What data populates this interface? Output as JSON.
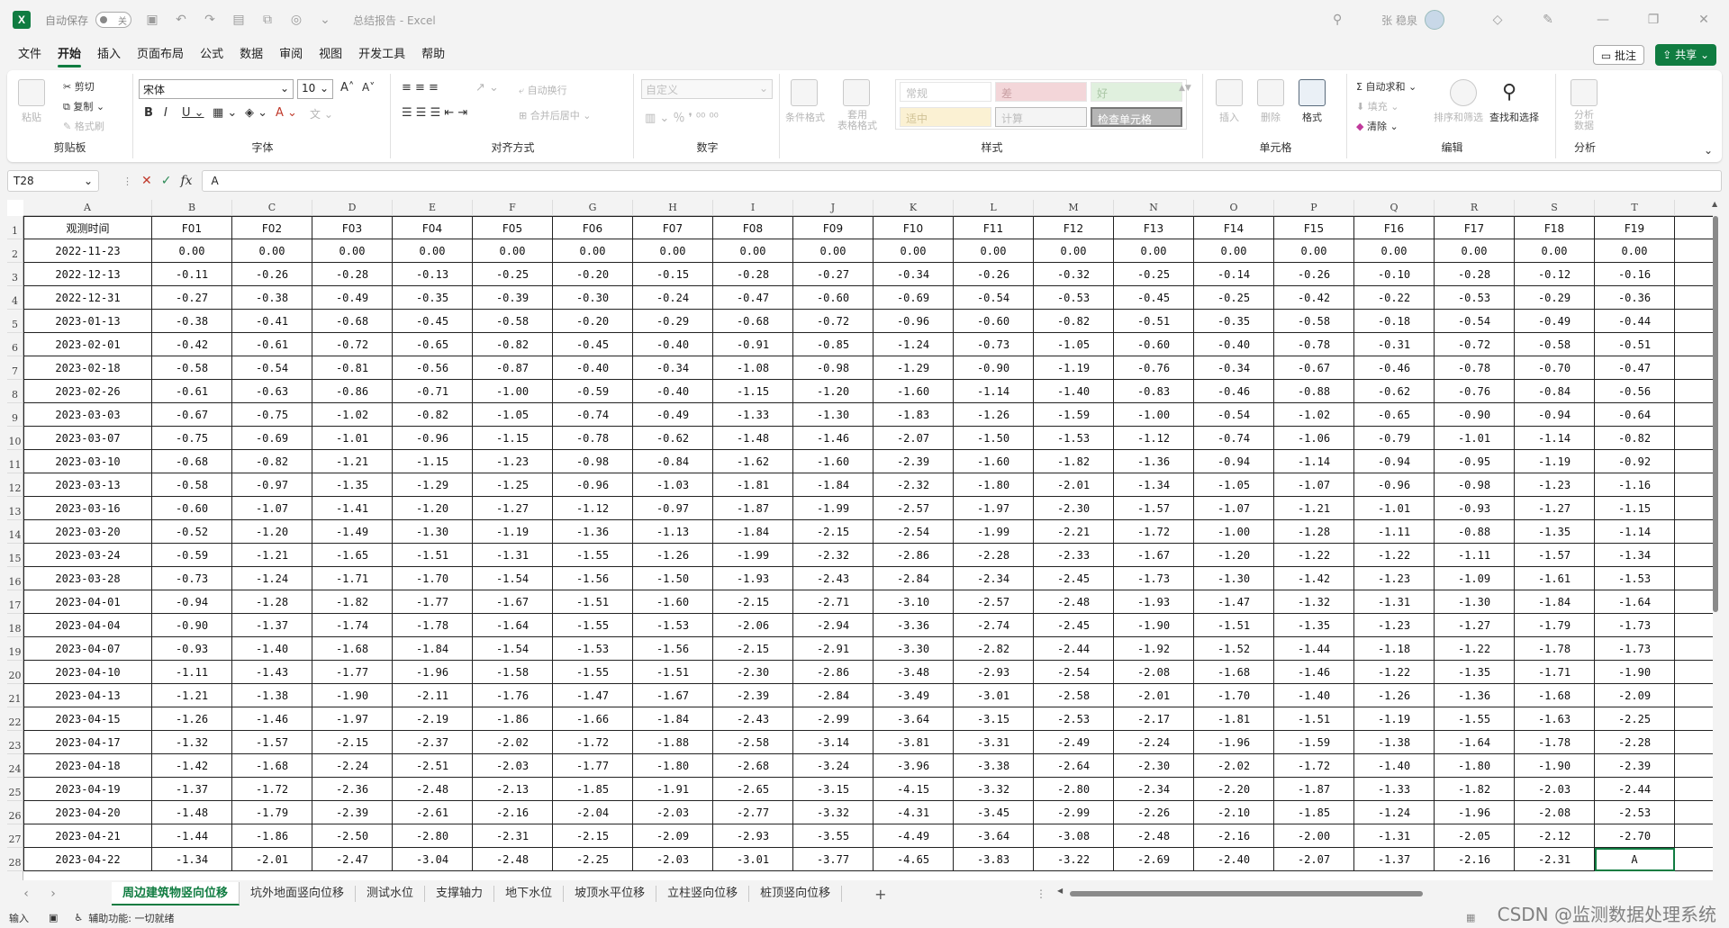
{
  "titlebar": {
    "autosave_label": "自动保存",
    "autosave_state": "关",
    "doc_title": "总结报告 - Excel",
    "user_name": "张 稳泉"
  },
  "menu": {
    "tabs": [
      "文件",
      "开始",
      "插入",
      "页面布局",
      "公式",
      "数据",
      "审阅",
      "视图",
      "开发工具",
      "帮助"
    ],
    "active_tab": "开始",
    "comment_label": "批注",
    "share_label": "共享"
  },
  "ribbon": {
    "clipboard": {
      "paste": "粘贴",
      "cut": "剪切",
      "copy": "复制",
      "format_painter": "格式刷",
      "label": "剪贴板"
    },
    "font": {
      "family": "宋体",
      "size": "10",
      "label": "字体"
    },
    "alignment": {
      "wrap": "自动换行",
      "merge": "合并后居中",
      "label": "对齐方式"
    },
    "number": {
      "format": "自定义",
      "label": "数字"
    },
    "styles": {
      "conditional": "条件格式",
      "table": "套用\n表格格式",
      "cells": [
        "常规",
        "差",
        "好",
        "适中",
        "计算",
        "检查单元格"
      ],
      "label": "样式"
    },
    "cells": {
      "insert": "插入",
      "delete": "删除",
      "format": "格式",
      "label": "单元格"
    },
    "editing": {
      "autosum": "自动求和",
      "fill": "填充",
      "clear": "清除",
      "sort": "排序和筛选",
      "find": "查找和选择",
      "label": "编辑"
    },
    "analysis": {
      "analyze": "分析\n数据",
      "label": "分析"
    }
  },
  "formula_bar": {
    "name_box": "T28",
    "content": "A"
  },
  "grid": {
    "col_letters": [
      "A",
      "B",
      "C",
      "D",
      "E",
      "F",
      "G",
      "H",
      "I",
      "J",
      "K",
      "L",
      "M",
      "N",
      "O",
      "P",
      "Q",
      "R",
      "S",
      "T"
    ],
    "header_row": [
      "观测时间",
      "F01",
      "F02",
      "F03",
      "F04",
      "F05",
      "F06",
      "F07",
      "F08",
      "F09",
      "F10",
      "F11",
      "F12",
      "F13",
      "F14",
      "F15",
      "F16",
      "F17",
      "F18",
      "F19"
    ],
    "rows": [
      [
        "2022-11-23",
        "0.00",
        "0.00",
        "0.00",
        "0.00",
        "0.00",
        "0.00",
        "0.00",
        "0.00",
        "0.00",
        "0.00",
        "0.00",
        "0.00",
        "0.00",
        "0.00",
        "0.00",
        "0.00",
        "0.00",
        "0.00",
        "0.00"
      ],
      [
        "2022-12-13",
        "-0.11",
        "-0.26",
        "-0.28",
        "-0.13",
        "-0.25",
        "-0.20",
        "-0.15",
        "-0.28",
        "-0.27",
        "-0.34",
        "-0.26",
        "-0.32",
        "-0.25",
        "-0.14",
        "-0.26",
        "-0.10",
        "-0.28",
        "-0.12",
        "-0.16"
      ],
      [
        "2022-12-31",
        "-0.27",
        "-0.38",
        "-0.49",
        "-0.35",
        "-0.39",
        "-0.30",
        "-0.24",
        "-0.47",
        "-0.60",
        "-0.69",
        "-0.54",
        "-0.53",
        "-0.45",
        "-0.25",
        "-0.42",
        "-0.22",
        "-0.53",
        "-0.29",
        "-0.36"
      ],
      [
        "2023-01-13",
        "-0.38",
        "-0.41",
        "-0.68",
        "-0.45",
        "-0.58",
        "-0.20",
        "-0.29",
        "-0.68",
        "-0.72",
        "-0.96",
        "-0.60",
        "-0.82",
        "-0.51",
        "-0.35",
        "-0.58",
        "-0.18",
        "-0.54",
        "-0.49",
        "-0.44"
      ],
      [
        "2023-02-01",
        "-0.42",
        "-0.61",
        "-0.72",
        "-0.65",
        "-0.82",
        "-0.45",
        "-0.40",
        "-0.91",
        "-0.85",
        "-1.24",
        "-0.73",
        "-1.05",
        "-0.60",
        "-0.40",
        "-0.78",
        "-0.31",
        "-0.72",
        "-0.58",
        "-0.51"
      ],
      [
        "2023-02-18",
        "-0.58",
        "-0.54",
        "-0.81",
        "-0.56",
        "-0.87",
        "-0.40",
        "-0.34",
        "-1.08",
        "-0.98",
        "-1.29",
        "-0.90",
        "-1.19",
        "-0.76",
        "-0.34",
        "-0.67",
        "-0.46",
        "-0.78",
        "-0.70",
        "-0.47"
      ],
      [
        "2023-02-26",
        "-0.61",
        "-0.63",
        "-0.86",
        "-0.71",
        "-1.00",
        "-0.59",
        "-0.40",
        "-1.15",
        "-1.20",
        "-1.60",
        "-1.14",
        "-1.40",
        "-0.83",
        "-0.46",
        "-0.88",
        "-0.62",
        "-0.76",
        "-0.84",
        "-0.56"
      ],
      [
        "2023-03-03",
        "-0.67",
        "-0.75",
        "-1.02",
        "-0.82",
        "-1.05",
        "-0.74",
        "-0.49",
        "-1.33",
        "-1.30",
        "-1.83",
        "-1.26",
        "-1.59",
        "-1.00",
        "-0.54",
        "-1.02",
        "-0.65",
        "-0.90",
        "-0.94",
        "-0.64"
      ],
      [
        "2023-03-07",
        "-0.75",
        "-0.69",
        "-1.01",
        "-0.96",
        "-1.15",
        "-0.78",
        "-0.62",
        "-1.48",
        "-1.46",
        "-2.07",
        "-1.50",
        "-1.53",
        "-1.12",
        "-0.74",
        "-1.06",
        "-0.79",
        "-1.01",
        "-1.14",
        "-0.82"
      ],
      [
        "2023-03-10",
        "-0.68",
        "-0.82",
        "-1.21",
        "-1.15",
        "-1.23",
        "-0.98",
        "-0.84",
        "-1.62",
        "-1.60",
        "-2.39",
        "-1.60",
        "-1.82",
        "-1.36",
        "-0.94",
        "-1.14",
        "-0.94",
        "-0.95",
        "-1.19",
        "-0.92"
      ],
      [
        "2023-03-13",
        "-0.58",
        "-0.97",
        "-1.35",
        "-1.29",
        "-1.25",
        "-0.96",
        "-1.03",
        "-1.81",
        "-1.84",
        "-2.32",
        "-1.80",
        "-2.01",
        "-1.34",
        "-1.05",
        "-1.07",
        "-0.96",
        "-0.98",
        "-1.23",
        "-1.16"
      ],
      [
        "2023-03-16",
        "-0.60",
        "-1.07",
        "-1.41",
        "-1.20",
        "-1.27",
        "-1.12",
        "-0.97",
        "-1.87",
        "-1.99",
        "-2.57",
        "-1.97",
        "-2.30",
        "-1.57",
        "-1.07",
        "-1.21",
        "-1.01",
        "-0.93",
        "-1.27",
        "-1.15"
      ],
      [
        "2023-03-20",
        "-0.52",
        "-1.20",
        "-1.49",
        "-1.30",
        "-1.19",
        "-1.36",
        "-1.13",
        "-1.84",
        "-2.15",
        "-2.54",
        "-1.99",
        "-2.21",
        "-1.72",
        "-1.00",
        "-1.28",
        "-1.11",
        "-0.88",
        "-1.35",
        "-1.14"
      ],
      [
        "2023-03-24",
        "-0.59",
        "-1.21",
        "-1.65",
        "-1.51",
        "-1.31",
        "-1.55",
        "-1.26",
        "-1.99",
        "-2.32",
        "-2.86",
        "-2.28",
        "-2.33",
        "-1.67",
        "-1.20",
        "-1.22",
        "-1.22",
        "-1.11",
        "-1.57",
        "-1.34"
      ],
      [
        "2023-03-28",
        "-0.73",
        "-1.24",
        "-1.71",
        "-1.70",
        "-1.54",
        "-1.56",
        "-1.50",
        "-1.93",
        "-2.43",
        "-2.84",
        "-2.34",
        "-2.45",
        "-1.73",
        "-1.30",
        "-1.42",
        "-1.23",
        "-1.09",
        "-1.61",
        "-1.53"
      ],
      [
        "2023-04-01",
        "-0.94",
        "-1.28",
        "-1.82",
        "-1.77",
        "-1.67",
        "-1.51",
        "-1.60",
        "-2.15",
        "-2.71",
        "-3.10",
        "-2.57",
        "-2.48",
        "-1.93",
        "-1.47",
        "-1.32",
        "-1.31",
        "-1.30",
        "-1.84",
        "-1.64"
      ],
      [
        "2023-04-04",
        "-0.90",
        "-1.37",
        "-1.74",
        "-1.78",
        "-1.64",
        "-1.55",
        "-1.53",
        "-2.06",
        "-2.94",
        "-3.36",
        "-2.74",
        "-2.45",
        "-1.90",
        "-1.51",
        "-1.35",
        "-1.23",
        "-1.27",
        "-1.79",
        "-1.73"
      ],
      [
        "2023-04-07",
        "-0.93",
        "-1.40",
        "-1.68",
        "-1.84",
        "-1.54",
        "-1.53",
        "-1.56",
        "-2.15",
        "-2.91",
        "-3.30",
        "-2.82",
        "-2.44",
        "-1.92",
        "-1.52",
        "-1.44",
        "-1.18",
        "-1.22",
        "-1.78",
        "-1.73"
      ],
      [
        "2023-04-10",
        "-1.11",
        "-1.43",
        "-1.77",
        "-1.96",
        "-1.58",
        "-1.55",
        "-1.51",
        "-2.30",
        "-2.86",
        "-3.48",
        "-2.93",
        "-2.54",
        "-2.08",
        "-1.68",
        "-1.46",
        "-1.22",
        "-1.35",
        "-1.71",
        "-1.90"
      ],
      [
        "2023-04-13",
        "-1.21",
        "-1.38",
        "-1.90",
        "-2.11",
        "-1.76",
        "-1.47",
        "-1.67",
        "-2.39",
        "-2.84",
        "-3.49",
        "-3.01",
        "-2.58",
        "-2.01",
        "-1.70",
        "-1.40",
        "-1.26",
        "-1.36",
        "-1.68",
        "-2.09"
      ],
      [
        "2023-04-15",
        "-1.26",
        "-1.46",
        "-1.97",
        "-2.19",
        "-1.86",
        "-1.66",
        "-1.84",
        "-2.43",
        "-2.99",
        "-3.64",
        "-3.15",
        "-2.53",
        "-2.17",
        "-1.81",
        "-1.51",
        "-1.19",
        "-1.55",
        "-1.63",
        "-2.25"
      ],
      [
        "2023-04-17",
        "-1.32",
        "-1.57",
        "-2.15",
        "-2.37",
        "-2.02",
        "-1.72",
        "-1.88",
        "-2.58",
        "-3.14",
        "-3.81",
        "-3.31",
        "-2.49",
        "-2.24",
        "-1.96",
        "-1.59",
        "-1.38",
        "-1.64",
        "-1.78",
        "-2.28"
      ],
      [
        "2023-04-18",
        "-1.42",
        "-1.68",
        "-2.24",
        "-2.51",
        "-2.03",
        "-1.77",
        "-1.80",
        "-2.68",
        "-3.24",
        "-3.96",
        "-3.38",
        "-2.64",
        "-2.30",
        "-2.02",
        "-1.72",
        "-1.40",
        "-1.80",
        "-1.90",
        "-2.39"
      ],
      [
        "2023-04-19",
        "-1.37",
        "-1.72",
        "-2.36",
        "-2.48",
        "-2.13",
        "-1.85",
        "-1.91",
        "-2.65",
        "-3.15",
        "-4.15",
        "-3.32",
        "-2.80",
        "-2.34",
        "-2.20",
        "-1.87",
        "-1.33",
        "-1.82",
        "-2.03",
        "-2.44"
      ],
      [
        "2023-04-20",
        "-1.48",
        "-1.79",
        "-2.39",
        "-2.61",
        "-2.16",
        "-2.04",
        "-2.03",
        "-2.77",
        "-3.32",
        "-4.31",
        "-3.45",
        "-2.99",
        "-2.26",
        "-2.10",
        "-1.85",
        "-1.24",
        "-1.96",
        "-2.08",
        "-2.53"
      ],
      [
        "2023-04-21",
        "-1.44",
        "-1.86",
        "-2.50",
        "-2.80",
        "-2.31",
        "-2.15",
        "-2.09",
        "-2.93",
        "-3.55",
        "-4.49",
        "-3.64",
        "-3.08",
        "-2.48",
        "-2.16",
        "-2.00",
        "-1.31",
        "-2.05",
        "-2.12",
        "-2.70"
      ],
      [
        "2023-04-22",
        "-1.34",
        "-2.01",
        "-2.47",
        "-3.04",
        "-2.48",
        "-2.25",
        "-2.03",
        "-3.01",
        "-3.77",
        "-4.65",
        "-3.83",
        "-3.22",
        "-2.69",
        "-2.40",
        "-2.07",
        "-1.37",
        "-2.16",
        "-2.31",
        "A"
      ]
    ]
  },
  "sheets": {
    "tabs": [
      "周边建筑物竖向位移",
      "坑外地面竖向位移",
      "测试水位",
      "支撑轴力",
      "地下水位",
      "坡顶水平位移",
      "立柱竖向位移",
      "桩顶竖向位移"
    ],
    "active": "周边建筑物竖向位移"
  },
  "status": {
    "mode": "输入",
    "accessibility": "辅助功能: 一切就绪",
    "watermark": "CSDN @监测数据处理系统"
  },
  "colors": {
    "accent": "#107c41",
    "selection": "#107c41"
  }
}
